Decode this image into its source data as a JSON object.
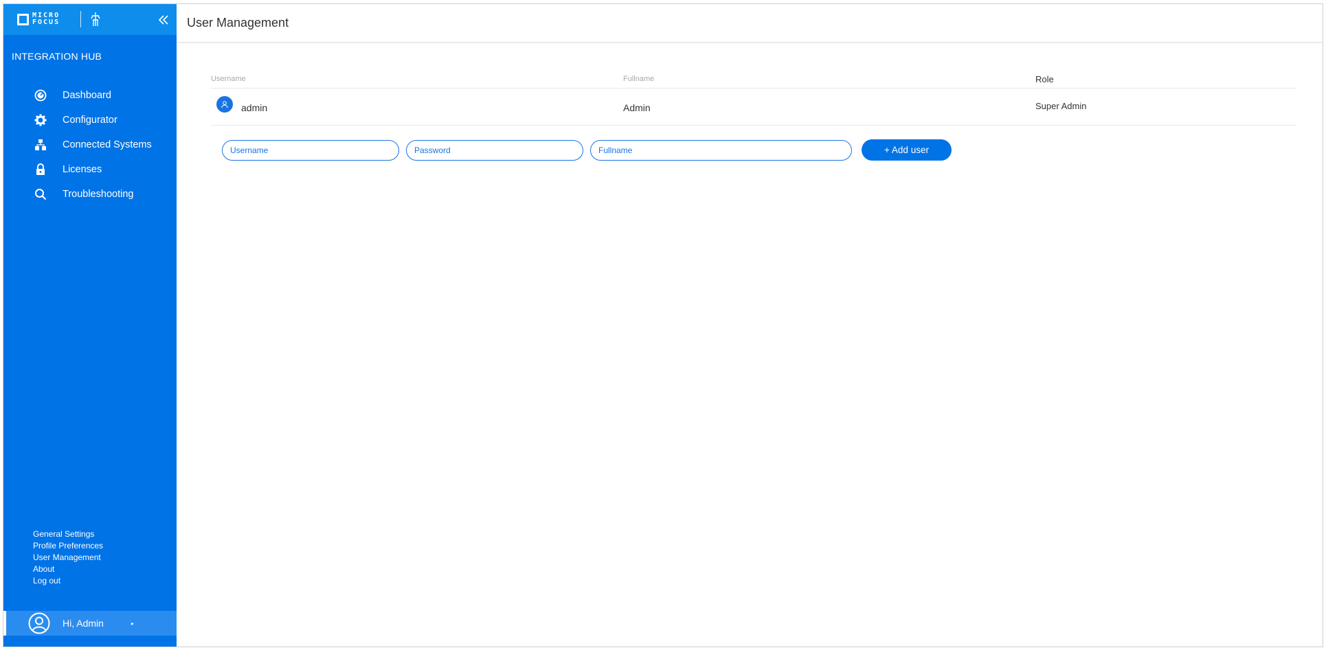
{
  "brand": {
    "logo_line1": "MICRO",
    "logo_line2": "FOCUS",
    "product": "INTEGRATION HUB"
  },
  "nav": {
    "items": [
      {
        "label": "Dashboard",
        "icon": "dashboard-icon"
      },
      {
        "label": "Configurator",
        "icon": "gear-icon"
      },
      {
        "label": "Connected Systems",
        "icon": "connected-systems-icon"
      },
      {
        "label": "Licenses",
        "icon": "lock-icon"
      },
      {
        "label": "Troubleshooting",
        "icon": "search-icon"
      }
    ]
  },
  "footer_links": {
    "general_settings": "General Settings",
    "profile_preferences": "Profile Preferences",
    "user_management": "User Management",
    "about": "About",
    "logout": "Log out"
  },
  "user": {
    "greeting": "Hi, Admin"
  },
  "page": {
    "title": "User Management"
  },
  "table": {
    "columns": {
      "username": "Username",
      "fullname": "Fullname",
      "role": "Role"
    },
    "rows": [
      {
        "username": "admin",
        "fullname": "Admin",
        "role": "Super Admin"
      }
    ]
  },
  "form": {
    "username_placeholder": "Username",
    "password_placeholder": "Password",
    "fullname_placeholder": "Fullname",
    "add_button": "+ Add user"
  },
  "colors": {
    "sidebar": "#0073e7",
    "brand_bar": "#0e8ded",
    "accent": "#1a73e2"
  }
}
